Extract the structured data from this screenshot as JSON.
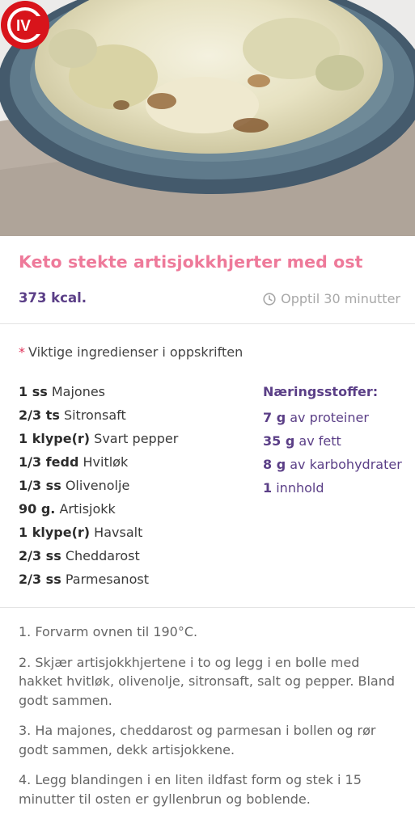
{
  "hero": {
    "image_alt": "Keto stekte artisjokkhjerter med ost",
    "logo_text": "IV"
  },
  "recipe": {
    "title": "Keto stekte artisjokkhjerter med ost",
    "kcal": "373 kcal.",
    "time": "Opptil 30 minutter",
    "key_ingredients_note": "Viktige ingredienser i oppskriften",
    "ingredients": [
      {
        "qty": "1 ss",
        "name": "Majones"
      },
      {
        "qty": "2/3 ts",
        "name": "Sitronsaft"
      },
      {
        "qty": "1 klype(r)",
        "name": "Svart pepper"
      },
      {
        "qty": "1/3 fedd",
        "name": "Hvitløk"
      },
      {
        "qty": "1/3 ss",
        "name": "Olivenolje"
      },
      {
        "qty": "90 g.",
        "name": "Artisjokk"
      },
      {
        "qty": "1 klype(r)",
        "name": "Havsalt"
      },
      {
        "qty": "2/3 ss",
        "name": "Cheddarost"
      },
      {
        "qty": "2/3 ss",
        "name": "Parmesanost"
      }
    ],
    "nutrients_title": "Næringsstoffer:",
    "nutrients": [
      {
        "value": "7 g",
        "label": "av proteiner"
      },
      {
        "value": "35 g",
        "label": "av fett"
      },
      {
        "value": "8 g",
        "label": "av karbohydrater"
      },
      {
        "value": "1",
        "label": "innhold"
      }
    ],
    "steps": [
      "1. Forvarm ovnen til 190°C.",
      "2. Skjær artisjokkhjertene i to og legg i en bolle med hakket hvitløk, olivenolje, sitronsaft, salt og pepper. Bland godt sammen.",
      "3. Ha majones, cheddarost og parmesan i bollen og rør godt sammen, dekk artisjokkene.",
      "4. Legg blandingen i en liten ildfast form og stek i 15 minutter til osten er gyllenbrun og boblende."
    ]
  },
  "colors": {
    "title": "#ee7a9a",
    "accent": "#5b3f87",
    "logo_red": "#d8141b"
  }
}
